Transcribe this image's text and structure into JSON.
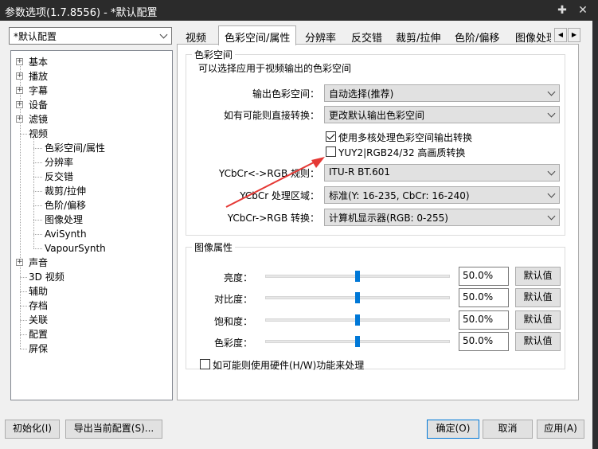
{
  "window": {
    "title": "参数选项(1.7.8556) - *默认配置",
    "pin_glyph": "✚",
    "close_glyph": "✕"
  },
  "profile": {
    "selected": "*默认配置"
  },
  "tree": {
    "items": [
      {
        "label": "基本",
        "expandable": true
      },
      {
        "label": "播放",
        "expandable": true
      },
      {
        "label": "字幕",
        "expandable": true
      },
      {
        "label": "设备",
        "expandable": true
      },
      {
        "label": "滤镜",
        "expandable": true
      },
      {
        "label": "视频",
        "expanded": true
      },
      {
        "label": "色彩空间/属性",
        "child": true,
        "selected": true
      },
      {
        "label": "分辨率",
        "child": true
      },
      {
        "label": "反交错",
        "child": true
      },
      {
        "label": "裁剪/拉伸",
        "child": true
      },
      {
        "label": "色阶/偏移",
        "child": true
      },
      {
        "label": "图像处理",
        "child": true
      },
      {
        "label": "AviSynth",
        "child": true
      },
      {
        "label": "VapourSynth",
        "child": true
      },
      {
        "label": "声音",
        "expandable": true
      },
      {
        "label": "3D 视频"
      },
      {
        "label": "辅助"
      },
      {
        "label": "存档"
      },
      {
        "label": "关联"
      },
      {
        "label": "配置"
      },
      {
        "label": "屏保"
      }
    ]
  },
  "tabs": [
    "视频",
    "色彩空间/属性",
    "分辨率",
    "反交错",
    "裁剪/拉伸",
    "色阶/偏移",
    "图像处理"
  ],
  "active_tab": 1,
  "tab_scroll": {
    "left": "◀",
    "right": "▶"
  },
  "colorspace": {
    "title": "色彩空间",
    "description": "可以选择应用于视频输出的色彩空间",
    "output_label": "输出色彩空间：",
    "output_value": "自动选择(推荐)",
    "direct_label": "如有可能则直接转换：",
    "direct_value": "更改默认输出色彩空间",
    "multicore_label": "使用多核处理色彩空间输出转换",
    "multicore_checked": true,
    "yuy2_label": "YUY2|RGB24/32 高画质转换",
    "yuy2_checked": false,
    "ycbcr_rgb_rule_label": "YCbCr<->RGB 规则：",
    "ycbcr_rgb_rule_value": "ITU-R BT.601",
    "ycbcr_range_label": "YCbCr 处理区域：",
    "ycbcr_range_value": "标准(Y: 16-235, CbCr: 16-240)",
    "ycbcr_convert_label": "YCbCr->RGB 转换：",
    "ycbcr_convert_value": "计算机显示器(RGB: 0-255)"
  },
  "image_props": {
    "title": "图像属性",
    "rows": [
      {
        "label": "亮度：",
        "value": "50.0%",
        "default_btn": "默认值",
        "level": 0.5
      },
      {
        "label": "对比度：",
        "value": "50.0%",
        "default_btn": "默认值",
        "level": 0.5
      },
      {
        "label": "饱和度：",
        "value": "50.0%",
        "default_btn": "默认值",
        "level": 0.5
      },
      {
        "label": "色彩度：",
        "value": "50.0%",
        "default_btn": "默认值",
        "level": 0.5
      }
    ]
  },
  "hardware": {
    "label": "如可能则使用硬件(H/W)功能来处理",
    "checked": false
  },
  "buttons": {
    "init": "初始化(I)",
    "export": "导出当前配置(S)...",
    "ok": "确定(O)",
    "cancel": "取消",
    "apply": "应用(A)"
  },
  "colors": {
    "accent": "#0078d7",
    "annotation_arrow": "#e53935"
  }
}
